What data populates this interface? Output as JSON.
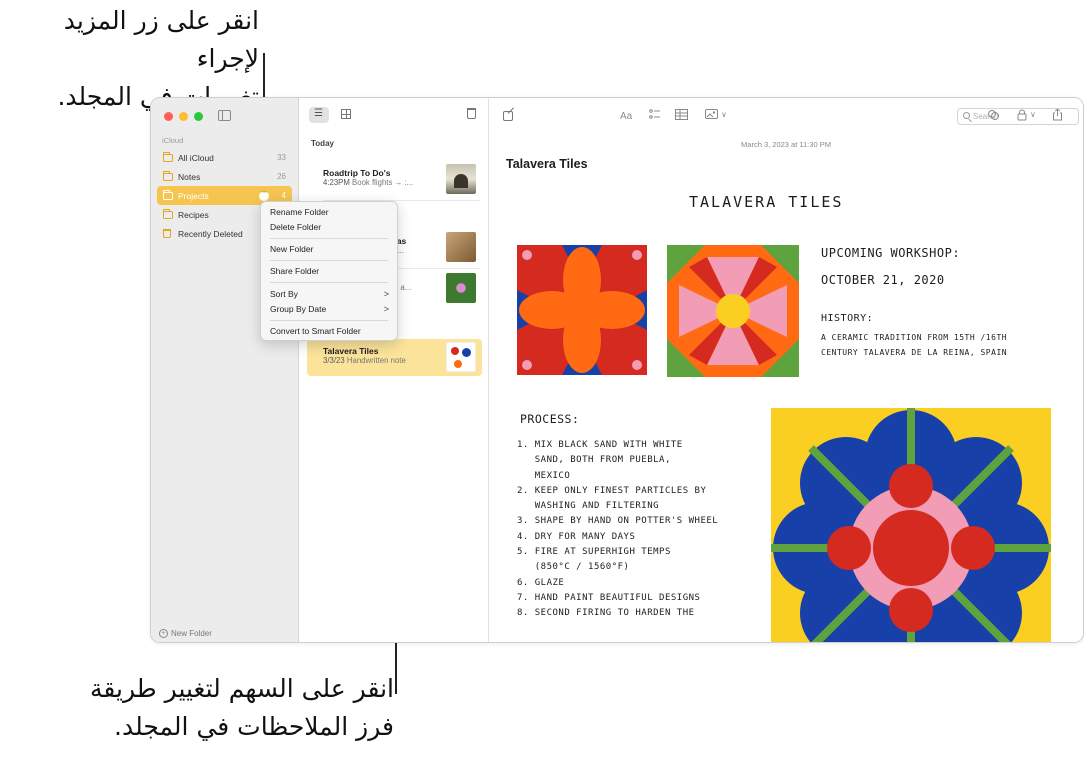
{
  "callouts": {
    "top_line1": "انقر على زر المزيد لإجراء",
    "top_line2": "تغييرات في المجلد.",
    "bottom_line1": "انقر على السهم لتغيير طريقة",
    "bottom_line2": "فرز الملاحظات في المجلد."
  },
  "sidebar": {
    "section_label": "iCloud",
    "folders": [
      {
        "label": "All iCloud",
        "count": "33"
      },
      {
        "label": "Notes",
        "count": "26"
      },
      {
        "label": "Projects",
        "count": "4",
        "selected": true
      },
      {
        "label": "Recipes",
        "count": ""
      },
      {
        "label": "Recently Deleted",
        "count": ""
      }
    ],
    "more_button": "•••",
    "new_folder_label": "New Folder"
  },
  "context_menu": {
    "items": [
      "Rename Folder",
      "Delete Folder",
      "New Folder",
      "Share Folder",
      "Sort By",
      "Group By Date",
      "Convert to Smart Folder"
    ],
    "submenu_arrow": ">"
  },
  "notes_list": {
    "section_header": "Today",
    "notes": [
      {
        "title": "Roadtrip To Do's",
        "time": "4:23PM",
        "preview": "Book flights → :..."
      },
      {
        "title": "g ideas",
        "time": "",
        "preview": "island..."
      },
      {
        "title": "",
        "time": "",
        "preview": "olorful a..."
      },
      {
        "title": "Talavera Tiles",
        "time": "3/3/23",
        "preview": "Handwritten note",
        "selected": true
      }
    ]
  },
  "editor": {
    "toolbar": {
      "format_label": "Aa",
      "lock_chevron": "∨",
      "attach_chevron": "∨"
    },
    "search_placeholder": "Search",
    "date": "March 3, 2023 at 11:30 PM",
    "title": "Talavera Tiles",
    "handwriting": {
      "title": "TALAVERA TILES",
      "upcoming": "UPCOMING WORKSHOP:",
      "date": "OCTOBER 21, 2020",
      "history_label": "HISTORY:",
      "history_text": "A CERAMIC TRADITION FROM 15TH /16TH\nCENTURY TALAVERA DE LA REINA, SPAIN",
      "process_label": "PROCESS:",
      "steps": "1. MIX BLACK SAND WITH WHITE\n   SAND, BOTH FROM PUEBLA,\n   MEXICO\n2. KEEP ONLY FINEST PARTICLES BY\n   WASHING AND FILTERING\n3. SHAPE BY HAND ON POTTER'S WHEEL\n4. DRY FOR MANY DAYS\n5. FIRE AT SUPERHIGH TEMPS\n   (850°C / 1560°F)\n6. GLAZE\n7. HAND PAINT BEAUTIFUL DESIGNS\n8. SECOND FIRING TO HARDEN THE"
    }
  },
  "colors": {
    "accent": "#f5c550",
    "selected_note": "#fbe49a",
    "tile_red": "#d42a1f",
    "tile_blue": "#1740a8",
    "tile_orange": "#ff6a13",
    "tile_green": "#5fa33f",
    "tile_pink": "#f29cb6",
    "tile_yellow": "#fbcf22"
  }
}
